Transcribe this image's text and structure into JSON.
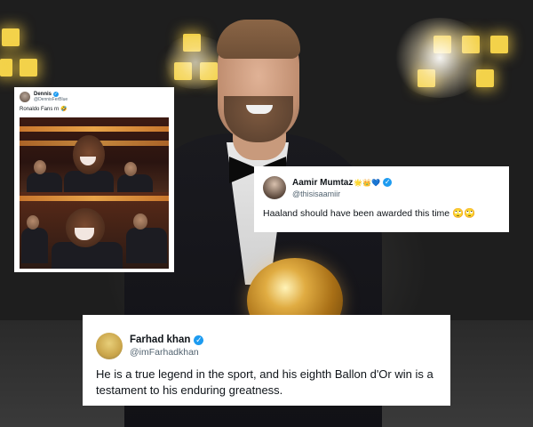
{
  "tweets": {
    "dennis": {
      "name": "Dennis",
      "handle": "@DennisFerBlue",
      "text": "Ronaldo Fans rn",
      "text_emoji": "🤣",
      "verified_glyph": "✓"
    },
    "aamir": {
      "name": "Aamir Mumtaz",
      "name_emojis": "🌟👑💙",
      "handle": "@thisisaamiir",
      "text": "Haaland should have been awarded this time",
      "text_emojis": "🙄🙄",
      "verified_glyph": "✓"
    },
    "farhad": {
      "name": "Farhad khan",
      "handle": "@imFarhadkhan",
      "text": "He is a true legend in the sport, and his eighth Ballon d'Or win is a testament to his enduring greatness.",
      "verified_glyph": "✓"
    }
  },
  "colors": {
    "verified_blue": "#1d9bf0",
    "handle_gray": "#536471",
    "stage_light": "#f3d24a"
  },
  "icons": [
    "verified-badge-icon",
    "avatar-image"
  ]
}
